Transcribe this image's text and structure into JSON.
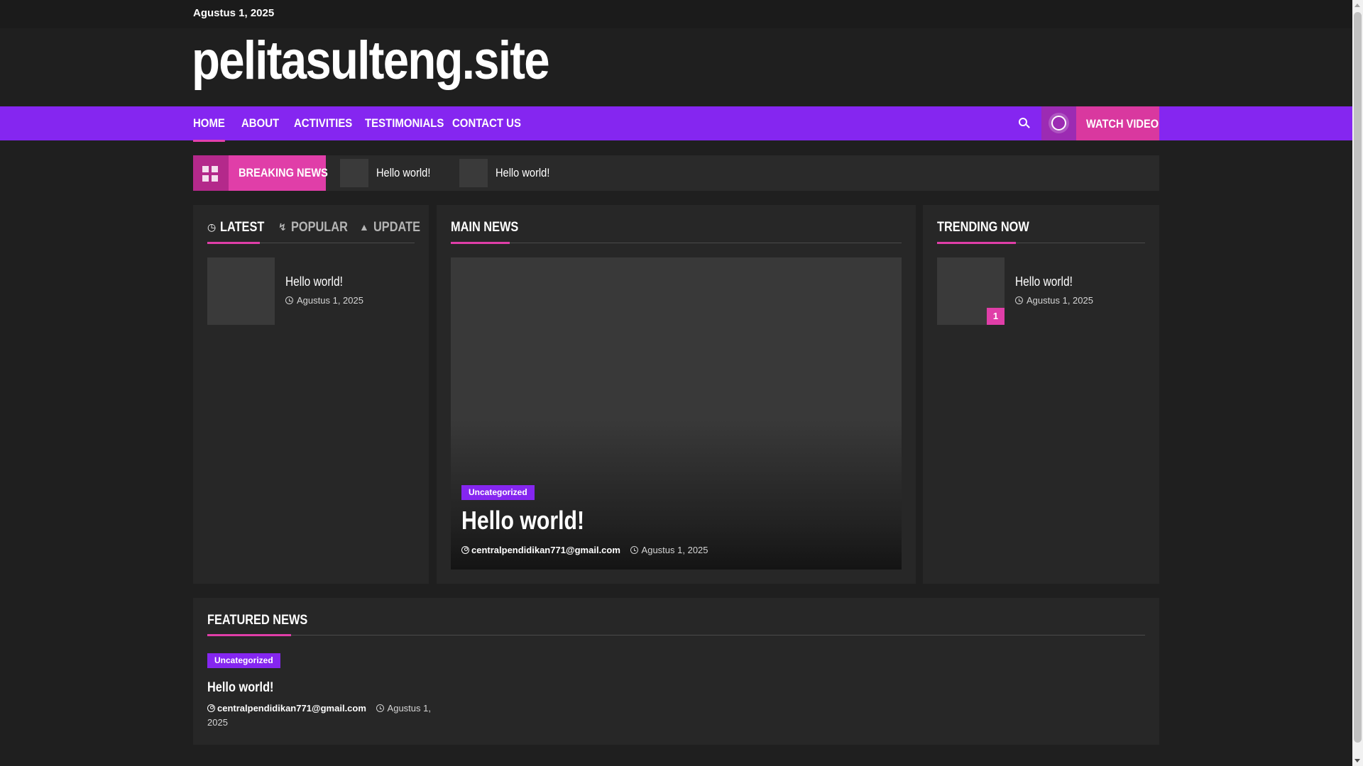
{
  "topbar": {
    "date": "Agustus 1, 2025"
  },
  "site": {
    "title": "pelitasulteng.site"
  },
  "nav": {
    "items": [
      {
        "label": "HOME"
      },
      {
        "label": "ABOUT"
      },
      {
        "label": "ACTIVITIES"
      },
      {
        "label": "TESTIMONIALS"
      },
      {
        "label": "CONTACT US"
      }
    ],
    "watch_video": "WATCH VIDEO"
  },
  "breaking": {
    "label": "BREAKING NEWS",
    "items": [
      {
        "title": "Hello world!"
      },
      {
        "title": "Hello world!"
      }
    ]
  },
  "tabs_panel": {
    "tabs": [
      {
        "label": "LATEST"
      },
      {
        "label": "POPULAR"
      },
      {
        "label": "UPDATE"
      }
    ],
    "post": {
      "title": "Hello world!",
      "date": "Agustus 1, 2025"
    }
  },
  "main_news": {
    "heading": "MAIN NEWS",
    "category": "Uncategorized",
    "title": "Hello world!",
    "author": "centralpendidikan771@gmail.com",
    "date": "Agustus 1, 2025"
  },
  "trending": {
    "heading": "TRENDING NOW",
    "post": {
      "rank": "1",
      "title": "Hello world!",
      "date": "Agustus 1, 2025"
    }
  },
  "featured": {
    "heading": "FEATURED NEWS",
    "category": "Uncategorized",
    "title": "Hello world!",
    "author": "centralpendidikan771@gmail.com",
    "date": "Agustus 1, 2025"
  },
  "colors": {
    "nav_bg": "#8526f0",
    "accent_pink": "#e03ea8",
    "page_bg": "#1f1f1f",
    "panel_bg": "#272727"
  }
}
